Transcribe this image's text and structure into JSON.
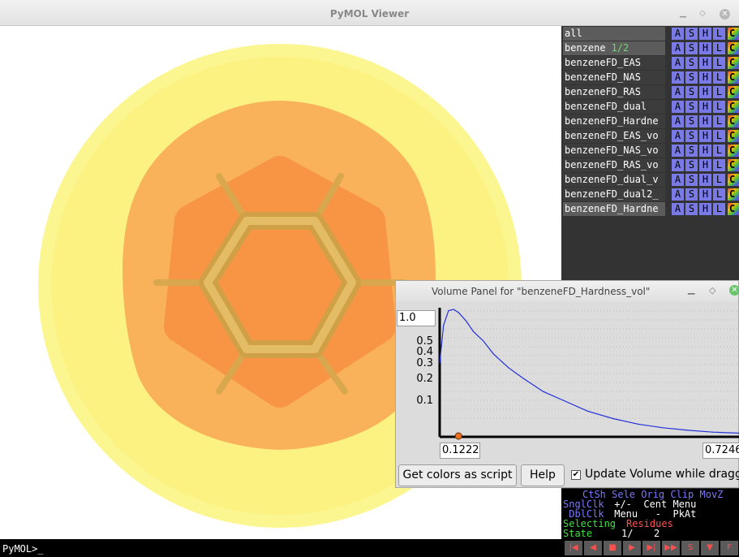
{
  "window": {
    "title": "PyMOL Viewer"
  },
  "command_line": {
    "text": "PyMOL>_"
  },
  "objects": [
    {
      "name": "all",
      "sub": "",
      "highlight": true
    },
    {
      "name": "benzene",
      "sub": "1/2",
      "highlight": true
    },
    {
      "name": "benzeneFD_EAS",
      "sub": "",
      "highlight": false
    },
    {
      "name": "benzeneFD_NAS",
      "sub": "",
      "highlight": false
    },
    {
      "name": "benzeneFD_RAS",
      "sub": "",
      "highlight": false
    },
    {
      "name": "benzeneFD_dual",
      "sub": "",
      "highlight": false
    },
    {
      "name": "benzeneFD_Hardne",
      "sub": "",
      "highlight": false
    },
    {
      "name": "benzeneFD_EAS_vo",
      "sub": "",
      "highlight": false
    },
    {
      "name": "benzeneFD_NAS_vo",
      "sub": "",
      "highlight": false
    },
    {
      "name": "benzeneFD_RAS_vo",
      "sub": "",
      "highlight": false
    },
    {
      "name": "benzeneFD_dual_v",
      "sub": "",
      "highlight": false
    },
    {
      "name": "benzeneFD_dual2_",
      "sub": "",
      "highlight": false
    },
    {
      "name": "benzeneFD_Hardne",
      "sub": "",
      "highlight": true
    }
  ],
  "object_buttons": [
    "A",
    "S",
    "H",
    "L",
    "C"
  ],
  "mouse_panel": {
    "line1": "CtSh Sele Orig Clip MovZ",
    "line2_label": "SnglClk",
    "line2_rest": " +/-  Cent Menu",
    "line3_label": " DblClk",
    "line3_rest": " Menu   -  PkAt",
    "selecting_label": "Selecting",
    "selecting_value": "Residues",
    "state_label": "State",
    "state_value": "1/",
    "state_total": "2"
  },
  "playback": [
    "|◀",
    "◀",
    "■",
    "▶",
    "▶|",
    "▶▶",
    "S",
    "▼",
    "F"
  ],
  "volume_panel": {
    "title": "Volume Panel for \"benzeneFD_Hardness_vol\"",
    "y_top_value": "1.0",
    "y_ticks": [
      "0.5",
      "0.4",
      "0.3",
      "0.2",
      "0.1"
    ],
    "x_min": "0.1222",
    "x_max": "0.7246",
    "get_colors_button": "Get colors as script",
    "help_button": "Help",
    "update_checkbox_label": "Update Volume while dragging",
    "update_checked": true
  },
  "chart_data": {
    "type": "line",
    "title": "",
    "xlabel": "",
    "ylabel": "",
    "xlim": [
      0.1222,
      0.7246
    ],
    "ylim": [
      0,
      1.0
    ],
    "x": [
      0.1222,
      0.13,
      0.14,
      0.15,
      0.16,
      0.175,
      0.19,
      0.21,
      0.23,
      0.26,
      0.29,
      0.33,
      0.37,
      0.42,
      0.47,
      0.52,
      0.57,
      0.62,
      0.67,
      0.7246
    ],
    "y": [
      0.3,
      0.75,
      0.98,
      1.0,
      0.95,
      0.82,
      0.65,
      0.5,
      0.38,
      0.27,
      0.2,
      0.14,
      0.1,
      0.07,
      0.05,
      0.035,
      0.025,
      0.018,
      0.013,
      0.01
    ],
    "control_point_x": 0.16
  }
}
